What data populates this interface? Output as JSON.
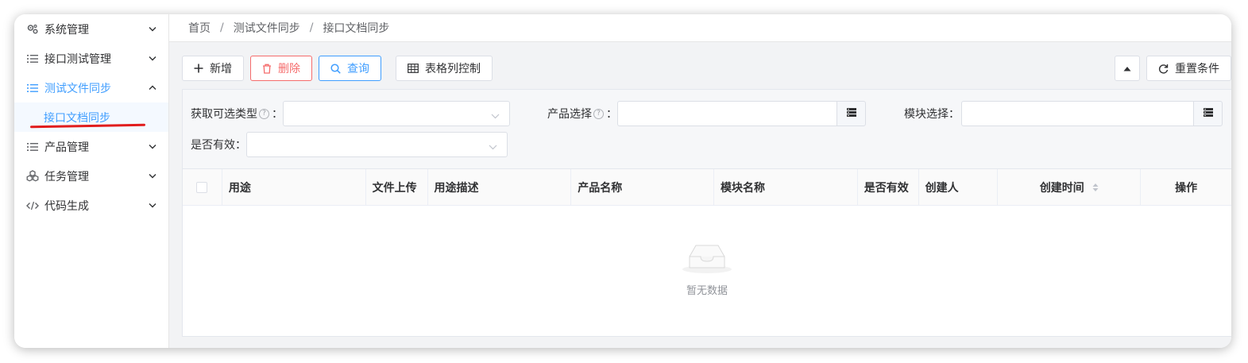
{
  "sidebar": {
    "items": [
      {
        "label": "系统管理",
        "icon": "gears-icon",
        "expanded": false
      },
      {
        "label": "接口测试管理",
        "icon": "list-icon",
        "expanded": false
      },
      {
        "label": "测试文件同步",
        "icon": "list-icon",
        "expanded": true,
        "active": true
      },
      {
        "label": "产品管理",
        "icon": "list-icon",
        "expanded": false
      },
      {
        "label": "任务管理",
        "icon": "cubes-icon",
        "expanded": false
      },
      {
        "label": "代码生成",
        "icon": "code-icon",
        "expanded": false
      }
    ],
    "submenu": {
      "label": "接口文档同步",
      "active": true
    }
  },
  "breadcrumb": [
    "首页",
    "测试文件同步",
    "接口文档同步"
  ],
  "toolbar": {
    "add_label": "新增",
    "delete_label": "删除",
    "query_label": "查询",
    "columns_label": "表格列控制",
    "reset_label": "重置条件"
  },
  "filters": {
    "type_label": "获取可选类型",
    "product_label": "产品选择",
    "module_label": "模块选择：",
    "valid_label": "是否有效：",
    "colon": "："
  },
  "table": {
    "columns": [
      "用途",
      "文件上传",
      "用途描述",
      "产品名称",
      "模块名称",
      "是否有效",
      "创建人",
      "创建时间",
      "操作"
    ],
    "rows": [],
    "empty_text": "暂无数据"
  },
  "colors": {
    "accent": "#409eff",
    "danger": "#f56c6c",
    "annotation": "#e11d1d"
  }
}
